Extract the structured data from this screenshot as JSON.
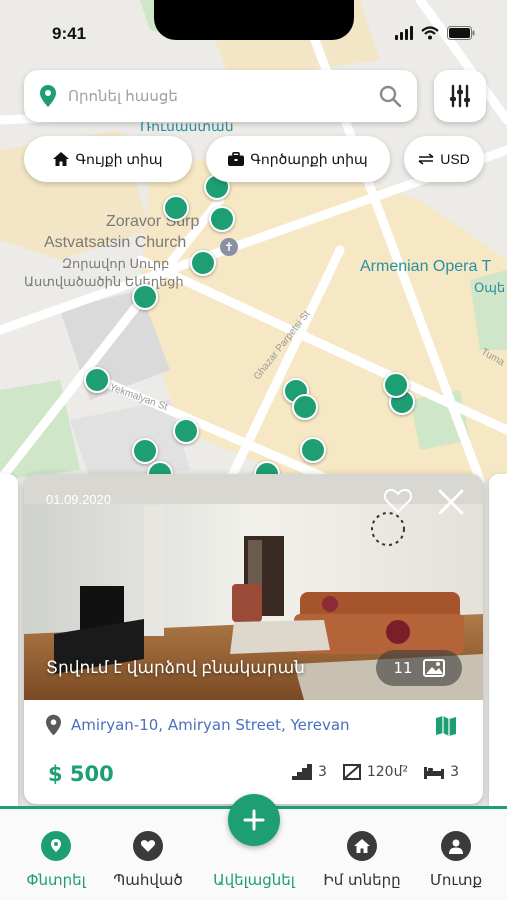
{
  "status_bar": {
    "time": "9:41"
  },
  "search": {
    "placeholder": "Որոնել հասցե"
  },
  "chips": {
    "home_type": "Գույքի տիպ",
    "deal_type": "Գործարքի տիպ",
    "currency": "USD"
  },
  "map": {
    "labels": {
      "top_partial": "Ռուսաստան",
      "church_en_1": "Zoravor Surp",
      "church_en_2": "Astvatsatsin Church",
      "church_hy_1": "Զորավոր Սուրբ",
      "church_hy_2": "Աստվածածին Եկեղեցի",
      "opera_en": "Armenian Opera T",
      "opera_hy": "Օպե",
      "street_parpetsi": "Ghazar Parpetsi St",
      "street_yekmalyan": "Yekmalyan St",
      "street_tumanyan": "Tuma"
    }
  },
  "card": {
    "date": "01.09.2020",
    "title": "Տրվում է վարձով բնակարան",
    "photo_count": "11",
    "address": "Amiryan-10, Amiryan Street, Yerevan",
    "price": "$ 500",
    "floor": "3",
    "area": "120մ²",
    "rooms": "3"
  },
  "nav": {
    "search": "Փնտրել",
    "saved": "Պահված",
    "add": "Ավելացնել",
    "my_homes": "Իմ տները",
    "login": "Մուտք"
  },
  "colors": {
    "accent": "#1e9f73",
    "address": "#4a6fbf",
    "park": "#cfe6c8",
    "map_base": "#ecebe7",
    "block": "#f6e8c4"
  },
  "icons": {
    "search_field": "location-pin-icon",
    "search_action": "magnifier-icon",
    "filter": "sliders-icon",
    "favorite": "heart-icon",
    "close": "close-icon",
    "gallery": "image-icon",
    "address": "location-pin-icon",
    "nav_search": "map-search-icon",
    "nav_saved": "heart-icon",
    "nav_add": "plus-icon",
    "nav_home": "home-icon",
    "nav_login": "user-icon"
  }
}
